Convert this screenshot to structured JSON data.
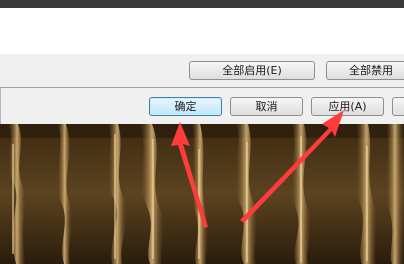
{
  "dialog": {
    "enable_all_label": "全部启用(E)",
    "disable_all_label": "全部禁用",
    "ok_label": "确定",
    "cancel_label": "取消",
    "apply_label": "应用(A)"
  },
  "colors": {
    "arrow": "#ff3b3b",
    "primary_border": "#3c7fb1",
    "wallpaper_dark": "#1c1208",
    "wallpaper_light": "#d8b070"
  },
  "icons": [
    "red-pointer-arrow"
  ]
}
